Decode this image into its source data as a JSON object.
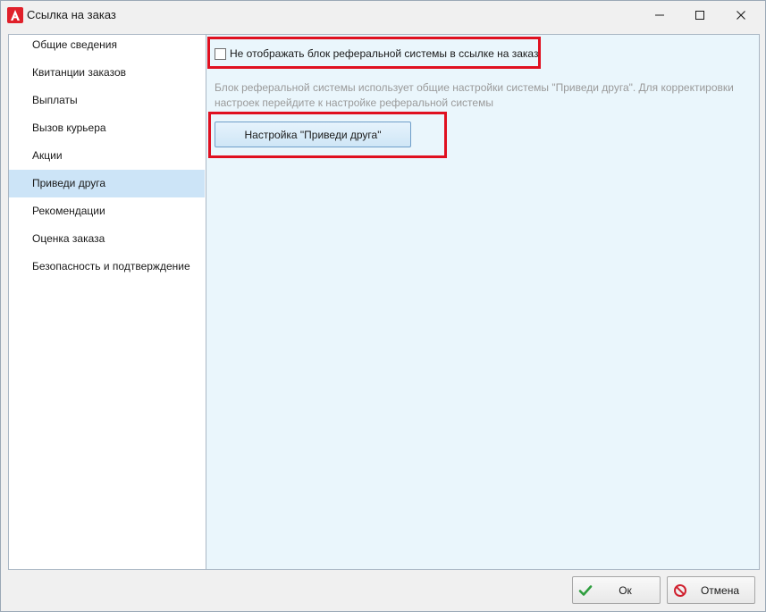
{
  "window": {
    "title": "Ссылка на заказ",
    "icon": "app-logo-icon",
    "controls": [
      "minimize-icon",
      "maximize-icon",
      "close-icon"
    ]
  },
  "sidebar": {
    "items": [
      {
        "label": "Общие сведения"
      },
      {
        "label": "Квитанции заказов"
      },
      {
        "label": "Выплаты"
      },
      {
        "label": "Вызов курьера"
      },
      {
        "label": "Акции"
      },
      {
        "label": "Приведи друга",
        "active": true
      },
      {
        "label": "Рекомендации"
      },
      {
        "label": "Оценка заказа"
      },
      {
        "label": "Безопасность и подтверждение"
      }
    ]
  },
  "content": {
    "checkbox": {
      "label": "Не отображать блок реферальной системы в ссылке на заказ",
      "checked": false
    },
    "description": "Блок реферальной системы использует общие настройки системы \"Приведи друга\". Для корректировки настроек перейдите к настройке реферальной системы",
    "settings_button": "Настройка \"Приведи друга\""
  },
  "footer": {
    "ok_label": "Ок",
    "cancel_label": "Отмена"
  },
  "colors": {
    "highlight_border": "#e01020",
    "selected_item": "#cce4f7",
    "content_background": "#eaf6fc",
    "ok_check": "#2e9e3e",
    "cancel_icon": "#d0202e"
  }
}
